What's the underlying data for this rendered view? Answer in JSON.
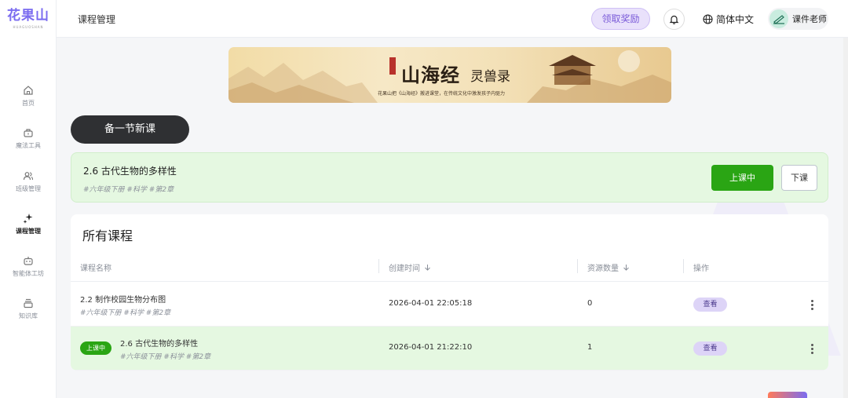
{
  "logo": {
    "text": "花果山",
    "sub": "HUAGUOSHAN"
  },
  "sidebar": {
    "items": [
      {
        "label": "首页",
        "icon": "home-icon"
      },
      {
        "label": "魔法工具",
        "icon": "magic-toolbox-icon"
      },
      {
        "label": "班级管理",
        "icon": "users-icon"
      },
      {
        "label": "课程管理",
        "icon": "sparkles-icon",
        "active": true
      },
      {
        "label": "智能体工坊",
        "icon": "robot-icon"
      },
      {
        "label": "知识库",
        "icon": "stack-icon"
      }
    ]
  },
  "header": {
    "title": "课程管理",
    "reward_label": "领取奖励",
    "lang_label": "简体中文",
    "user_label": "课件老师"
  },
  "banner": {
    "title": "山海经",
    "subtitle": "灵兽录",
    "caption": "花果山把《山海经》搬进课堂，在传统文化中激发孩子内驱力"
  },
  "new_lesson_label": "备一节新课",
  "current_lesson": {
    "title": "2.6 古代生物的多样性",
    "tags": "#六年级下册  #科学  #第2章",
    "live_label": "上课中",
    "end_label": "下课"
  },
  "course_list": {
    "title": "所有课程",
    "columns": [
      "课程名称",
      "创建时间",
      "资源数量",
      "操作"
    ],
    "rows": [
      {
        "name": "2.2 制作校园生物分布图",
        "tags": "#六年级下册  #科学  #第2章",
        "created": "2026-04-01 22:05:18",
        "resources": "0",
        "action": "查看",
        "live": false
      },
      {
        "name": "2.6 古代生物的多样性",
        "tags": "#六年级下册  #科学  #第2章",
        "created": "2026-04-01 21:22:10",
        "resources": "1",
        "action": "查看",
        "live": true,
        "badge": "上课中"
      }
    ]
  },
  "colors": {
    "accent": "#7b6cf0",
    "live_green": "#2aa514",
    "live_bg": "#e5f8e1",
    "dark_button": "#2f3033"
  }
}
